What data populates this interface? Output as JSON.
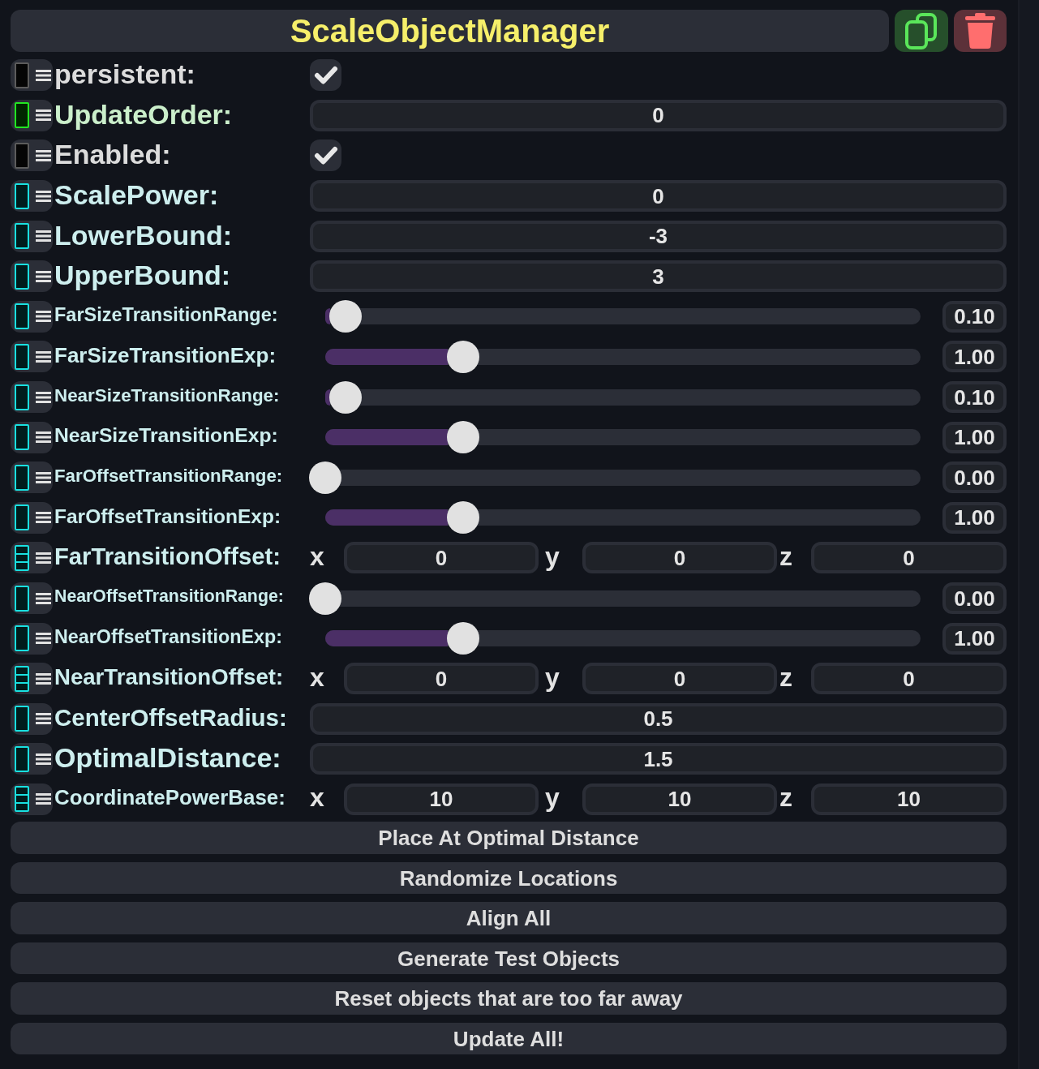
{
  "header": {
    "title": "ScaleObjectManager"
  },
  "fields": [
    {
      "kind": "bool",
      "label": "persistent:",
      "checked": true
    },
    {
      "kind": "int",
      "label": "UpdateOrder:",
      "value": "0"
    },
    {
      "kind": "bool",
      "label": "Enabled:",
      "checked": true
    },
    {
      "kind": "float",
      "label": "ScalePower:",
      "value": "0"
    },
    {
      "kind": "float",
      "label": "LowerBound:",
      "value": "-3"
    },
    {
      "kind": "float",
      "label": "UpperBound:",
      "value": "3"
    },
    {
      "kind": "slider",
      "label": "FarSizeTransitionRange:",
      "level": 0.034,
      "reading": "0.10"
    },
    {
      "kind": "slider",
      "label": "FarSizeTransitionExp:",
      "level": 0.232,
      "reading": "1.00"
    },
    {
      "kind": "slider",
      "label": "NearSizeTransitionRange:",
      "level": 0.034,
      "reading": "0.10"
    },
    {
      "kind": "slider",
      "label": "NearSizeTransitionExp:",
      "level": 0.232,
      "reading": "1.00"
    },
    {
      "kind": "slider",
      "label": "FarOffsetTransitionRange:",
      "level": 0,
      "reading": "0.00"
    },
    {
      "kind": "slider",
      "label": "FarOffsetTransitionExp:",
      "level": 0.232,
      "reading": "1.00"
    },
    {
      "kind": "vector",
      "label": "FarTransitionOffset:",
      "components": [
        {
          "axis": "x",
          "value": "0"
        },
        {
          "axis": "y",
          "value": "0"
        },
        {
          "axis": "z",
          "value": "0"
        }
      ]
    },
    {
      "kind": "slider",
      "label": "NearOffsetTransitionRange:",
      "level": 0,
      "reading": "0.00"
    },
    {
      "kind": "slider",
      "label": "NearOffsetTransitionExp:",
      "level": 0.232,
      "reading": "1.00"
    },
    {
      "kind": "vector",
      "label": "NearTransitionOffset:",
      "components": [
        {
          "axis": "x",
          "value": "0"
        },
        {
          "axis": "y",
          "value": "0"
        },
        {
          "axis": "z",
          "value": "0"
        }
      ]
    },
    {
      "kind": "float",
      "label": "CenterOffsetRadius:",
      "value": "0.5"
    },
    {
      "kind": "float",
      "label": "OptimalDistance:",
      "value": "1.5"
    },
    {
      "kind": "vector",
      "label": "CoordinatePowerBase:",
      "components": [
        {
          "axis": "x",
          "value": "10"
        },
        {
          "axis": "y",
          "value": "10"
        },
        {
          "axis": "z",
          "value": "10"
        }
      ]
    }
  ],
  "buttons": [
    "Place At Optimal Distance",
    "Randomize Locations",
    "Align All",
    "Generate Test Objects",
    "Reset objects that are too far away",
    "Update All!"
  ]
}
